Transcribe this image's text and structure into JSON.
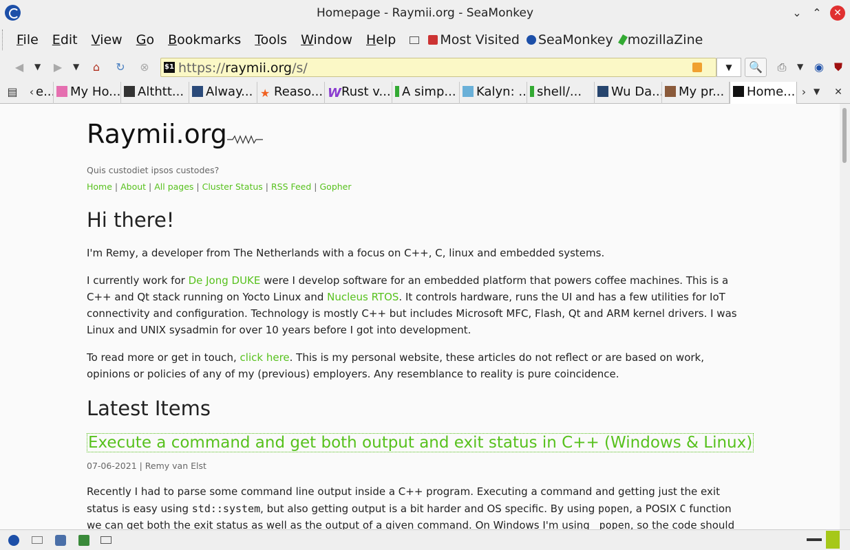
{
  "window": {
    "title": "Homepage - Raymii.org - SeaMonkey"
  },
  "menubar": {
    "items": [
      {
        "label_u": "F",
        "label_rest": "ile"
      },
      {
        "label_u": "E",
        "label_rest": "dit"
      },
      {
        "label_u": "V",
        "label_rest": "iew"
      },
      {
        "label_u": "G",
        "label_rest": "o"
      },
      {
        "label_u": "B",
        "label_rest": "ookmarks"
      },
      {
        "label_u": "T",
        "label_rest": "ools"
      },
      {
        "label_u": "W",
        "label_rest": "indow"
      },
      {
        "label_u": "H",
        "label_rest": "elp"
      }
    ],
    "bookmarks": [
      "Most Visited",
      "SeaMonkey",
      "mozillaZine"
    ]
  },
  "navbar": {
    "url_prefix": "https://",
    "url_host": "raymii.org",
    "url_path": "/s/",
    "site_icon_text": "$1"
  },
  "tabs": [
    {
      "label": "e..."
    },
    {
      "label": "My Ho..."
    },
    {
      "label": "Althtt..."
    },
    {
      "label": "Alway..."
    },
    {
      "label": "Reaso..."
    },
    {
      "label": "Rust v..."
    },
    {
      "label": "A simp..."
    },
    {
      "label": "Kalyn: ..."
    },
    {
      "label": "shell/..."
    },
    {
      "label": "Wu Da..."
    },
    {
      "label": "My pr..."
    },
    {
      "label": "Home..."
    }
  ],
  "page": {
    "site_name": "Raymii.org",
    "tagline": "Quis custodiet ipsos custodes?",
    "nav": [
      "Home",
      "About",
      "All pages",
      "Cluster Status",
      "RSS Feed",
      "Gopher"
    ],
    "heading": "Hi there!",
    "intro": "I'm Remy, a developer from The Netherlands with a focus on C++, C, linux and embedded systems.",
    "p2_a": "I currently work for ",
    "p2_link1": "De Jong DUKE",
    "p2_b": " were I develop software for an embedded platform that powers coffee machines. This is a C++ and Qt stack running on Yocto Linux and ",
    "p2_link2": "Nucleus RTOS",
    "p2_c": ". It controls hardware, runs the UI and has a few utilities for IoT connectivity and configuration. Technology is mostly C++ but includes Microsoft MFC, Flash, Qt and ARM kernel drivers. I was Linux and UNIX sysadmin for over 10 years before I got into development.",
    "p3_a": "To read more or get in touch, ",
    "p3_link": "click here",
    "p3_b": ". This is my personal website, these articles do not reflect or are based on work, opinions or policies of any of my (previous) employers. Any resemblance to reality is pure coincidence.",
    "latest_heading": "Latest Items",
    "article": {
      "title": "Execute a command and get both output and exit status in C++ (Windows & Linux)",
      "meta": "07-06-2021 | Remy van Elst",
      "s1": "Recently I had to parse some command line output inside a C++ program. Executing a command and getting just the exit status is easy using ",
      "code1": "std::system",
      "s2": ", but also getting output is a bit harder and OS specific. By using ",
      "code2": "popen",
      "s3": ", a POSIX ",
      "code3": "C",
      "s4": " function we can get both the exit status as well as the output of a given command. On Windows I'm using ",
      "code4": "_popen",
      "s5": ", so the code should be cross platform, except for"
    }
  },
  "colors": {
    "link": "#57c11d",
    "urlbar_bg": "#fbf8c6",
    "close_btn": "#e03030"
  }
}
